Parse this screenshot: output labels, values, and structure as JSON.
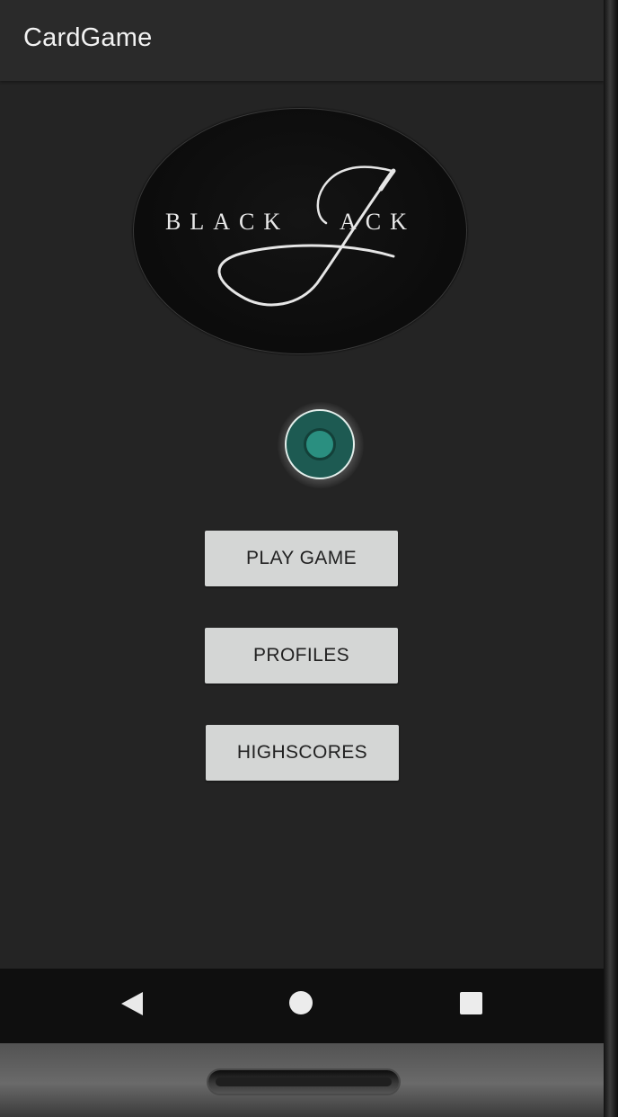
{
  "app": {
    "title": "CardGame"
  },
  "logo": {
    "text_left": "BLACK",
    "text_right": "ACK"
  },
  "menu": {
    "play_label": "PLAY GAME",
    "profiles_label": "PROFILES",
    "highscores_label": "HIGHSCORES"
  },
  "system_nav": {
    "icons": [
      "back-icon",
      "home-icon",
      "recents-icon"
    ]
  },
  "colors": {
    "background": "#242424",
    "app_bar": "#2a2a2a",
    "button": "#d4d6d5",
    "spinner_teal": "#2a8f80"
  }
}
